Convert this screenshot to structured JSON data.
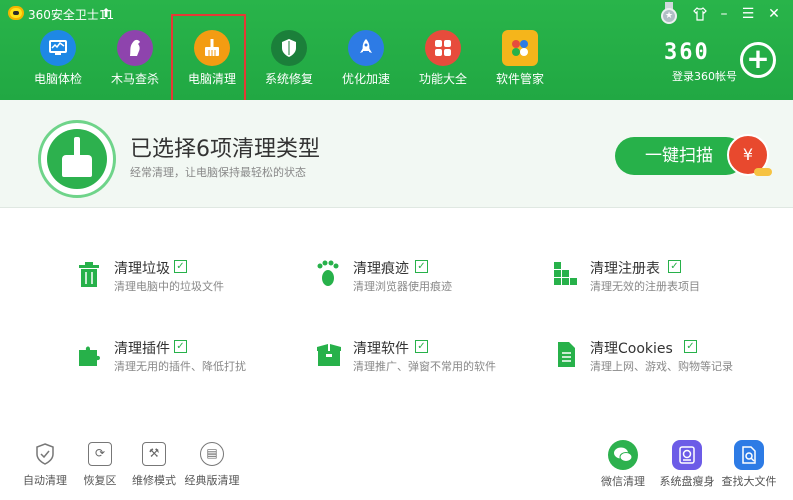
{
  "titlebar": {
    "title": "360安全卫士11",
    "upgrade_icon": "up-arrow-icon",
    "controls": [
      "medal-icon",
      "shirt-icon",
      "minimize-icon",
      "menu-icon",
      "close-icon"
    ]
  },
  "nav": {
    "items": [
      {
        "label": "电脑体检",
        "icon": "monitor-icon",
        "color": "#1e88e5"
      },
      {
        "label": "木马查杀",
        "icon": "horse-icon",
        "color": "#8e44ad"
      },
      {
        "label": "电脑清理",
        "icon": "broom-icon",
        "color": "#f39c12"
      },
      {
        "label": "系统修复",
        "icon": "shield-icon",
        "color": "#1b7f3a"
      },
      {
        "label": "优化加速",
        "icon": "rocket-icon",
        "color": "#2d7be5"
      },
      {
        "label": "功能大全",
        "icon": "grid-icon",
        "color": "#e74c3c"
      },
      {
        "label": "软件管家",
        "icon": "apps-icon",
        "color": "#f5b51b"
      }
    ]
  },
  "brand": {
    "logo": "360",
    "login": "登录360帐号"
  },
  "summary": {
    "headline": "已选择6项清理类型",
    "subhead": "经常清理，让电脑保持最轻松的状态",
    "scan_button": "一键扫描",
    "scan_icon": "money-bag-icon",
    "scan_symbol": "¥"
  },
  "clean_items": [
    {
      "name": "清理垃圾",
      "desc": "清理电脑中的垃圾文件",
      "icon": "trash-icon",
      "checked": true
    },
    {
      "name": "清理痕迹",
      "desc": "清理浏览器使用痕迹",
      "icon": "footprint-icon",
      "checked": true
    },
    {
      "name": "清理注册表",
      "desc": "清理无效的注册表项目",
      "icon": "registry-icon",
      "checked": true
    },
    {
      "name": "清理插件",
      "desc": "清理无用的插件、降低打扰",
      "icon": "puzzle-icon",
      "checked": true
    },
    {
      "name": "清理软件",
      "desc": "清理推广、弹窗不常用的软件",
      "icon": "box-icon",
      "checked": true
    },
    {
      "name": "清理Cookies",
      "desc": "清理上网、游戏、购物等记录",
      "icon": "document-icon",
      "checked": true
    }
  ],
  "tools_left": [
    {
      "label": "自动清理",
      "icon": "shield-check-icon"
    },
    {
      "label": "恢复区",
      "icon": "restore-icon"
    },
    {
      "label": "维修模式",
      "icon": "wrench-icon"
    },
    {
      "label": "经典版清理",
      "icon": "classic-icon"
    }
  ],
  "tools_right": [
    {
      "label": "微信清理",
      "icon": "wechat-icon",
      "color": "#2db14e"
    },
    {
      "label": "系统盘瘦身",
      "icon": "disk-icon",
      "color": "#6c5ce7"
    },
    {
      "label": "查找大文件",
      "icon": "file-search-icon",
      "color": "#2d7be5"
    }
  ],
  "colors": {
    "header": "#26b046",
    "accent": "#27b14a",
    "highlight": "#e53935"
  }
}
